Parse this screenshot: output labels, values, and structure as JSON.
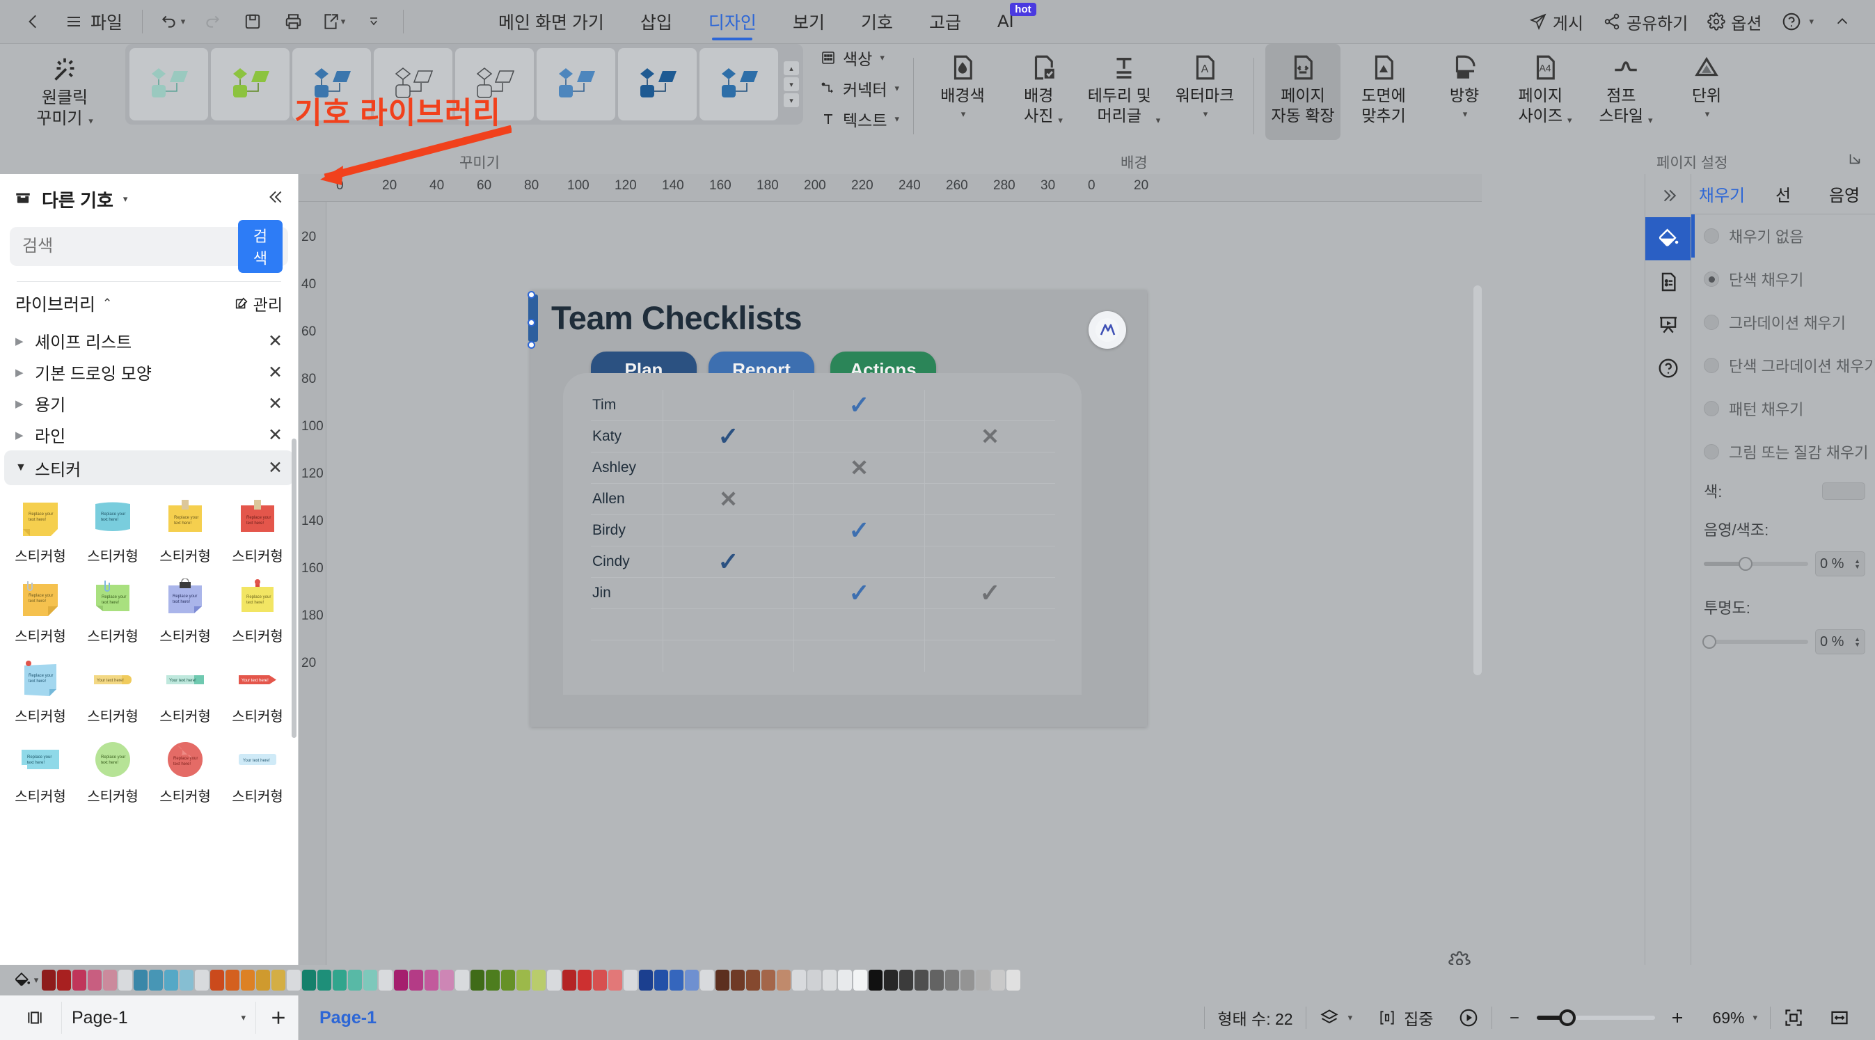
{
  "app": {
    "quick_access": [
      "back-icon",
      "file-menu",
      "undo-icon",
      "redo-icon",
      "save-icon",
      "print-icon",
      "export-icon",
      "more-icon"
    ],
    "file_label": "파일"
  },
  "menu": {
    "items": [
      {
        "label": "메인 화면 가기",
        "active": false
      },
      {
        "label": "삽입",
        "active": false
      },
      {
        "label": "디자인",
        "active": true
      },
      {
        "label": "보기",
        "active": false
      },
      {
        "label": "기호",
        "active": false
      },
      {
        "label": "고급",
        "active": false
      },
      {
        "label": "AI",
        "active": false,
        "badge": "hot"
      }
    ]
  },
  "top_right": [
    {
      "label": "게시",
      "icon": "publish-icon"
    },
    {
      "label": "공유하기",
      "icon": "share-icon"
    },
    {
      "label": "옵션",
      "icon": "gear-icon"
    },
    {
      "label": "",
      "icon": "help-icon"
    },
    {
      "label": "",
      "icon": "collapse-ribbon-icon"
    }
  ],
  "ribbon": {
    "oneclick": {
      "line1": "원클릭",
      "line2": "꾸미기"
    },
    "gallery_caption": "꾸미기",
    "theme_items": [
      "theme-teal",
      "theme-green",
      "theme-blue",
      "theme-outline-1",
      "theme-outline-2",
      "theme-blue-2",
      "theme-navy",
      "theme-steel"
    ],
    "small_buttons": [
      {
        "label": "색상",
        "icon": "color-grid-icon"
      },
      {
        "label": "커넥터",
        "icon": "connector-icon"
      },
      {
        "label": "텍스트",
        "icon": "text-icon"
      }
    ],
    "background_group": {
      "caption": "배경",
      "buttons": [
        {
          "label": "배경색",
          "icon": "fill-doc-icon",
          "dropdown": true,
          "selected": false
        },
        {
          "label": "배경\n사진",
          "icon": "bg-photo-icon",
          "dropdown": true,
          "selected": false
        },
        {
          "label": "테두리 및\n머리글",
          "icon": "border-header-icon",
          "dropdown": true,
          "selected": false
        },
        {
          "label": "워터마크",
          "icon": "watermark-icon",
          "dropdown": true,
          "selected": false
        }
      ]
    },
    "page_group": {
      "caption": "페이지 설정",
      "buttons": [
        {
          "label": "페이지\n자동 확장",
          "icon": "auto-expand-icon",
          "dropdown": false,
          "selected": true
        },
        {
          "label": "도면에\n맞추기",
          "icon": "fit-drawing-icon",
          "dropdown": false,
          "selected": false
        },
        {
          "label": "방향",
          "icon": "orientation-icon",
          "dropdown": true,
          "selected": false
        },
        {
          "label": "페이지\n사이즈",
          "icon": "page-size-icon",
          "dropdown": true,
          "selected": false
        },
        {
          "label": "점프\n스타일",
          "icon": "jump-style-icon",
          "dropdown": true,
          "selected": false
        },
        {
          "label": "단위",
          "icon": "unit-icon",
          "dropdown": true,
          "selected": false
        }
      ]
    }
  },
  "left_panel": {
    "title": "다른 기호",
    "collapse_icon": "chevron-double-left-icon",
    "search": {
      "placeholder": "검색",
      "button": "검색"
    },
    "library": {
      "title": "라이브러리",
      "manage": "관리"
    },
    "categories": [
      {
        "label": "셰이프 리스트",
        "open": false
      },
      {
        "label": "기본 드로잉 모양",
        "open": false
      },
      {
        "label": "용기",
        "open": false
      },
      {
        "label": "라인",
        "open": false
      },
      {
        "label": "스티커",
        "open": true
      }
    ],
    "stickers": [
      {
        "name": "스티커형",
        "style": "note-yellow",
        "text": "Replace your text here!"
      },
      {
        "name": "스티커형",
        "style": "note-cyan",
        "text": "Replace your text here!"
      },
      {
        "name": "스티커형",
        "style": "note-yellow-tape",
        "text": "Replace your text here!"
      },
      {
        "name": "스티커형",
        "style": "note-red-tape",
        "text": "Replace your text here!"
      },
      {
        "name": "스티커형",
        "style": "note-orange-clip",
        "text": "Replace your text here!"
      },
      {
        "name": "스티커형",
        "style": "note-green-clip",
        "text": "Replace your text here!"
      },
      {
        "name": "스티커형",
        "style": "note-blue-binder",
        "text": "Replace your text here!"
      },
      {
        "name": "스티커형",
        "style": "note-yellow-pin",
        "text": "Replace your text here!"
      },
      {
        "name": "스티커형",
        "style": "note-blue-pin",
        "text": "Replace your text here!"
      },
      {
        "name": "스티커형",
        "style": "tag-yellow",
        "text": "Your text here!"
      },
      {
        "name": "스티커형",
        "style": "tag-teal",
        "text": "Your text here!"
      },
      {
        "name": "스티커형",
        "style": "tag-red-arrow",
        "text": "Your text here!"
      },
      {
        "name": "스티커형",
        "style": "label-cyan",
        "text": "Replace your text here!"
      },
      {
        "name": "스티커형",
        "style": "circle-green",
        "text": "Replace your text here!"
      },
      {
        "name": "스티커형",
        "style": "circle-red",
        "text": "Replace your text here!"
      },
      {
        "name": "스티커형",
        "style": "label-lightblue",
        "text": "Your text here!"
      }
    ]
  },
  "annotation": {
    "text": "기호 라이브러리",
    "color": "#f1411c"
  },
  "canvas": {
    "ruler_h_ticks": [
      "0",
      "20",
      "40",
      "60",
      "80",
      "100",
      "120",
      "140",
      "160",
      "180",
      "200",
      "220",
      "240",
      "260",
      "280",
      "30"
    ],
    "ruler_v_ticks": [
      "20",
      "40",
      "60",
      "80",
      "100",
      "120",
      "140",
      "160",
      "180",
      "20"
    ],
    "document": {
      "title": "Team Checklists",
      "headers": [
        {
          "label": "Plan",
          "color": "#2b5181"
        },
        {
          "label": "Report",
          "color": "#3d6fb0"
        },
        {
          "label": "Actions",
          "color": "#2b8558"
        }
      ],
      "rows": [
        {
          "name": "Tim",
          "marks": [
            "",
            "check",
            ""
          ]
        },
        {
          "name": "Katy",
          "marks": [
            "check",
            "",
            "cross"
          ]
        },
        {
          "name": "Ashley",
          "marks": [
            "",
            "cross",
            ""
          ]
        },
        {
          "name": "Allen",
          "marks": [
            "cross",
            "",
            ""
          ]
        },
        {
          "name": "Birdy",
          "marks": [
            "",
            "check",
            ""
          ]
        },
        {
          "name": "Cindy",
          "marks": [
            "check",
            "",
            ""
          ]
        },
        {
          "name": "Jin",
          "marks": [
            "",
            "check",
            "check-gray"
          ]
        },
        {
          "name": "",
          "marks": [
            "",
            "",
            ""
          ]
        },
        {
          "name": "",
          "marks": [
            "",
            "",
            ""
          ]
        }
      ],
      "check_color": "#3d6fb0",
      "cross_color": "#6f7174"
    }
  },
  "right_panel": {
    "rail": [
      "expand-panel-icon",
      "fill-bucket-icon",
      "properties-icon",
      "present-icon",
      "help-circle-icon"
    ],
    "tabs": [
      {
        "label": "채우기",
        "active": true
      },
      {
        "label": "선",
        "active": false
      },
      {
        "label": "음영",
        "active": false
      }
    ],
    "fill_options": [
      {
        "label": "채우기 없음",
        "selected": false
      },
      {
        "label": "단색 채우기",
        "selected": true
      },
      {
        "label": "그라데이션 채우기",
        "selected": false
      },
      {
        "label": "단색 그라데이션 채우기",
        "selected": false
      },
      {
        "label": "패턴 채우기",
        "selected": false
      },
      {
        "label": "그림 또는 질감 채우기",
        "selected": false
      }
    ],
    "color_field": {
      "label": "색:",
      "value": ""
    },
    "shade_field": {
      "label": "음영/색조:",
      "value": "0 %",
      "percent": 35
    },
    "opacity_field": {
      "label": "투명도:",
      "value": "0 %",
      "percent": 0
    }
  },
  "palette": {
    "tool_icon": "fill-bucket-small-icon",
    "colors": [
      "#8e1c1c",
      "#a82020",
      "#c0355a",
      "#c85e80",
      "#cb8a9c",
      "#d8dadd",
      "#3a87a8",
      "#4796b5",
      "#55a8c6",
      "#86bed2",
      "#d8dadd",
      "#cb4a1c",
      "#d4601f",
      "#dd8124",
      "#cf9a2e",
      "#d4ae44",
      "#d8dadd",
      "#15806b",
      "#1e8f79",
      "#31a58d",
      "#58b9a6",
      "#7ec8bb",
      "#d8dadd",
      "#a51f6e",
      "#b43b86",
      "#c25a9c",
      "#cd86b5",
      "#d8dadd",
      "#3f6b18",
      "#4d7d1e",
      "#669127",
      "#9cb94a",
      "#b9cc6c",
      "#d8dadd",
      "#b42424",
      "#cd3030",
      "#d75050",
      "#e27878",
      "#d8dadd",
      "#1b3f8f",
      "#2250a8",
      "#3566bd",
      "#6f90d0",
      "#d8dadd",
      "#5c2f1f",
      "#6f3a26",
      "#85492f",
      "#a4664a",
      "#c08a6c",
      "#d8dadd",
      "#cfd1d4",
      "#dcdee0",
      "#e8eaec",
      "#f2f4f5",
      "#111111",
      "#272727",
      "#3b3b3b",
      "#4f4f4f",
      "#636363",
      "#7a7a7a",
      "#949494",
      "#b0b0b0",
      "#c9c9c9",
      "#e0e0e0"
    ]
  },
  "status_bar": {
    "page_selector": "Page-1",
    "page_tab": "Page-1",
    "shape_count": "형태 수: 22",
    "layer_label": "",
    "focus_label": "집중",
    "zoom_level": "69%",
    "icons": [
      "layout-icon",
      "add-page-icon",
      "layers-icon",
      "focus-icon",
      "play-icon",
      "zoom-out-icon",
      "zoom-in-icon",
      "fit-page-icon",
      "fit-width-icon"
    ]
  }
}
